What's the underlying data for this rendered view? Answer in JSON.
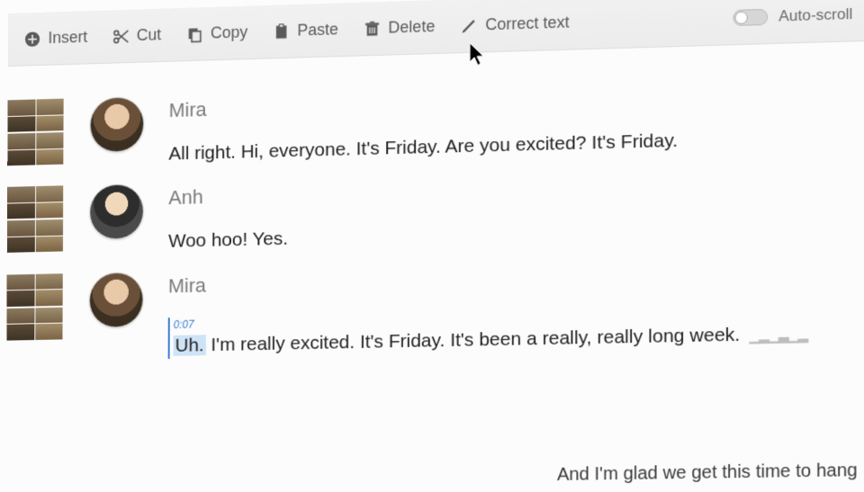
{
  "toolbar": {
    "insert": "Insert",
    "cut": "Cut",
    "copy": "Copy",
    "paste": "Paste",
    "delete": "Delete",
    "correct": "Correct text",
    "autoscroll": "Auto-scroll"
  },
  "transcript": [
    {
      "speaker": "Mira",
      "text": "All right. Hi, everyone. It's Friday. Are you excited? It's Friday."
    },
    {
      "speaker": "Anh",
      "text": "Woo hoo! Yes."
    },
    {
      "speaker": "Mira",
      "timestamp": "0:07",
      "highlight": "Uh.",
      "text": "I'm really excited. It's Friday. It's been a really, really long week."
    }
  ],
  "cutoff_text": "And I'm glad we get this time to hang"
}
